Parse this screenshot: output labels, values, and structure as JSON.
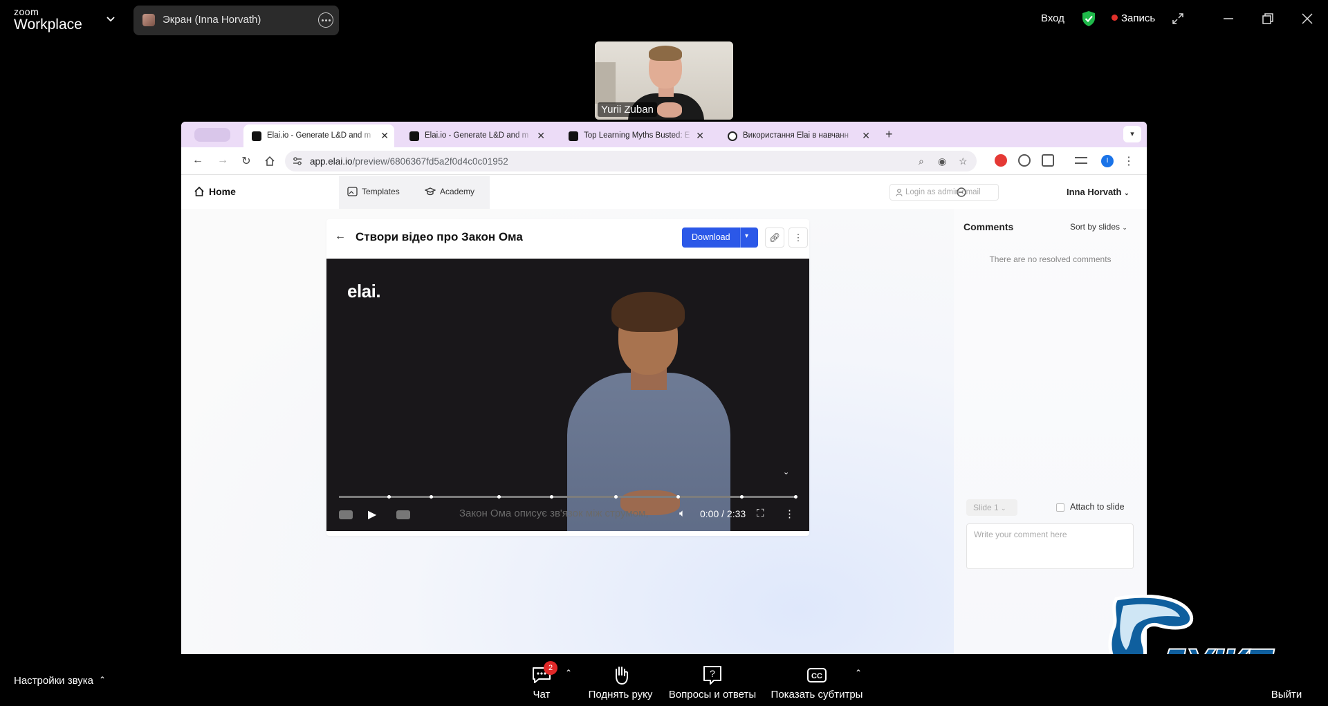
{
  "zoom": {
    "brand_small": "zoom",
    "brand_big": "Workplace",
    "share_label": "Экран (Inna Horvath)",
    "signin": "Вход",
    "record": "Запись",
    "participant_name": "Yurii Zuban"
  },
  "browser": {
    "tabs": [
      {
        "title": "Elai.io - Generate L&D and m",
        "active": true
      },
      {
        "title": "Elai.io - Generate L&D and m",
        "active": false
      },
      {
        "title": "Top Learning Myths Busted: E",
        "active": false
      },
      {
        "title": "Використання Elai в навчанн",
        "active": false
      }
    ],
    "url_host": "app.elai.io",
    "url_path": "/preview/6806367fd5a2f0d4c0c01952",
    "profile_initial": "I"
  },
  "app": {
    "home": "Home",
    "templates": "Templates",
    "academy": "Academy",
    "login_placeholder": "Login as admin email",
    "user_name": "Inna Horvath"
  },
  "video": {
    "title": "Створи відео про Закон Ома",
    "download": "Download",
    "logo": "elai.",
    "caption": "Закон Ома описує зв'язок між струмом,",
    "time": "0:00 / 2:33",
    "progress": 0.0
  },
  "comments": {
    "title": "Comments",
    "sort": "Sort by slides",
    "empty": "There are no resolved comments",
    "slide": "Slide 1",
    "attach": "Attach to slide",
    "placeholder": "Write your comment here"
  },
  "bottombar": {
    "audio_settings": "Настройки звука",
    "chat": "Чат",
    "chat_badge": "2",
    "raise_hand": "Поднять руку",
    "qa": "Вопросы и ответы",
    "captions": "Показать субтитры",
    "leave": "Выйти"
  },
  "overlay_logo": "ДУІКТ",
  "colors": {
    "accent": "#2b58e8",
    "record": "#e0302a",
    "badge": "#e02828",
    "tabstrip": "#ecdcf7"
  }
}
